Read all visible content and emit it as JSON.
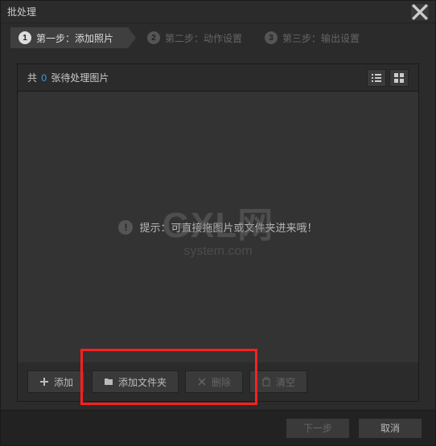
{
  "window": {
    "title": "批处理"
  },
  "steps": [
    {
      "num": "1",
      "label": "第一步：添加照片"
    },
    {
      "num": "2",
      "label": "第二步：动作设置"
    },
    {
      "num": "3",
      "label": "第三步：输出设置"
    }
  ],
  "list": {
    "prefix": "共",
    "count": "0",
    "suffix": "张待处理图片"
  },
  "hint": {
    "text": "提示：可直接拖图片或文件夹进来哦！"
  },
  "watermark": {
    "big": "GXL网",
    "small": "system.com"
  },
  "toolbar": {
    "add": "添加",
    "addFolder": "添加文件夹",
    "delete": "删除",
    "clear": "清空"
  },
  "footer": {
    "next": "下一步",
    "cancel": "取消"
  }
}
